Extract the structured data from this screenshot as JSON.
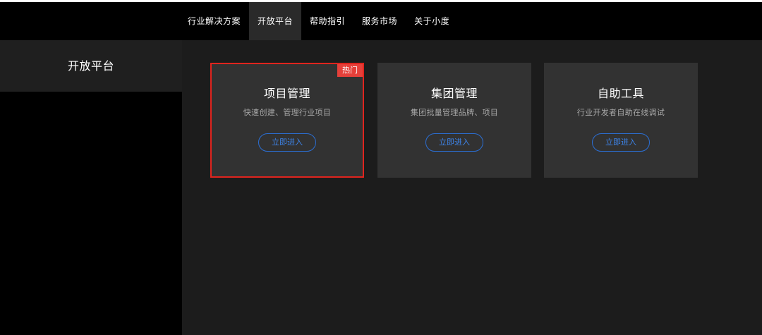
{
  "nav": {
    "items": [
      {
        "label": "行业解决方案"
      },
      {
        "label": "开放平台"
      },
      {
        "label": "帮助指引"
      },
      {
        "label": "服务市场"
      },
      {
        "label": "关于小度"
      }
    ],
    "active_index": 1
  },
  "sidebar": {
    "title": "开放平台"
  },
  "cards": [
    {
      "title": "项目管理",
      "desc": "快速创建、管理行业项目",
      "button": "立即进入",
      "badge": "热门"
    },
    {
      "title": "集团管理",
      "desc": "集团批量管理品牌、项目",
      "button": "立即进入"
    },
    {
      "title": "自助工具",
      "desc": "行业开发者自助在线调试",
      "button": "立即进入"
    }
  ],
  "colors": {
    "highlight_border": "#e0241e",
    "badge_bg": "#e5403a",
    "button_accent": "#3d84ea"
  }
}
